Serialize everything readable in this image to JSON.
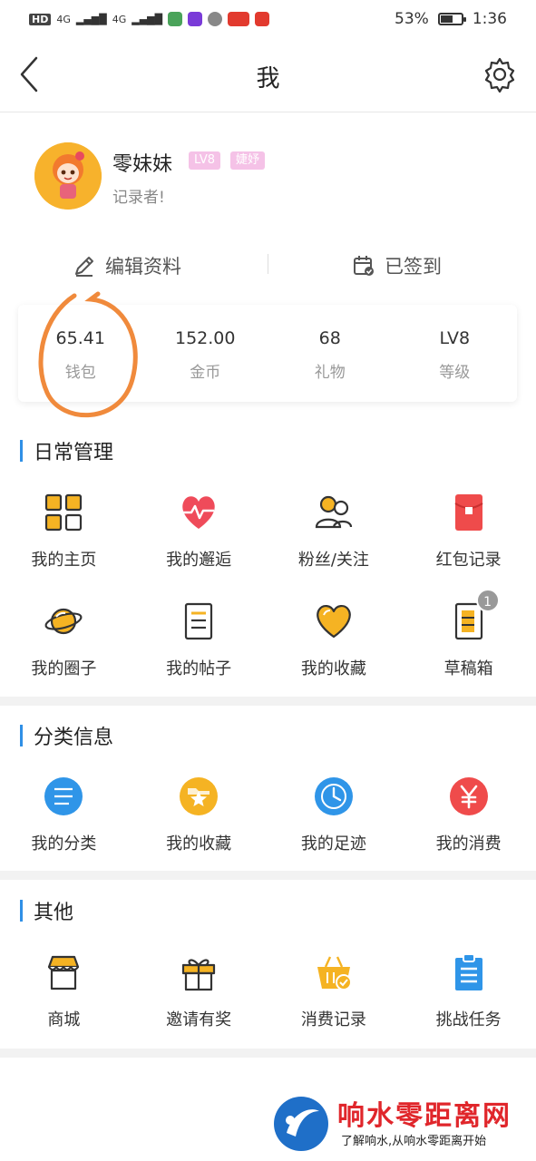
{
  "status_bar": {
    "left_text": "HD",
    "network_1": "4G",
    "network_2": "4G",
    "battery": "53%",
    "time": "1:36"
  },
  "header": {
    "title": "我",
    "back_icon": "chevron-left-icon",
    "settings_icon": "gear-icon"
  },
  "profile": {
    "name": "零妹妹",
    "level_badge": "LV8",
    "tag_badge": "婕妤",
    "description": "记录者!"
  },
  "actions": {
    "edit": "编辑资料",
    "sign_in": "已签到"
  },
  "stats": [
    {
      "value": "65.41",
      "label": "钱包"
    },
    {
      "value": "152.00",
      "label": "金币"
    },
    {
      "value": "68",
      "label": "礼物"
    },
    {
      "value": "LV8",
      "label": "等级"
    }
  ],
  "sections": {
    "daily": {
      "title": "日常管理",
      "items": [
        {
          "label": "我的主页",
          "icon": "grid-icon"
        },
        {
          "label": "我的邂逅",
          "icon": "heart-pulse-icon"
        },
        {
          "label": "粉丝/关注",
          "icon": "users-icon"
        },
        {
          "label": "红包记录",
          "icon": "red-envelope-icon"
        },
        {
          "label": "我的圈子",
          "icon": "planet-icon"
        },
        {
          "label": "我的帖子",
          "icon": "note-icon"
        },
        {
          "label": "我的收藏",
          "icon": "heart-icon"
        },
        {
          "label": "草稿箱",
          "icon": "draft-icon",
          "badge": "1"
        }
      ]
    },
    "category": {
      "title": "分类信息",
      "items": [
        {
          "label": "我的分类",
          "icon": "list-circle-icon"
        },
        {
          "label": "我的收藏",
          "icon": "star-folder-icon"
        },
        {
          "label": "我的足迹",
          "icon": "clock-icon"
        },
        {
          "label": "我的消费",
          "icon": "yen-icon"
        }
      ]
    },
    "other": {
      "title": "其他",
      "items": [
        {
          "label": "商城",
          "icon": "shop-icon"
        },
        {
          "label": "邀请有奖",
          "icon": "gift-icon"
        },
        {
          "label": "消费记录",
          "icon": "basket-icon"
        },
        {
          "label": "挑战任务",
          "icon": "clipboard-icon"
        }
      ]
    }
  },
  "watermark": {
    "title": "响水零距离网",
    "subtitle": "了解响水,从响水零距离开始"
  },
  "colors": {
    "accent": "#2f8fe6",
    "gold": "#f5b323",
    "red": "#ef4b4b",
    "annotation": "#f08a3c"
  }
}
